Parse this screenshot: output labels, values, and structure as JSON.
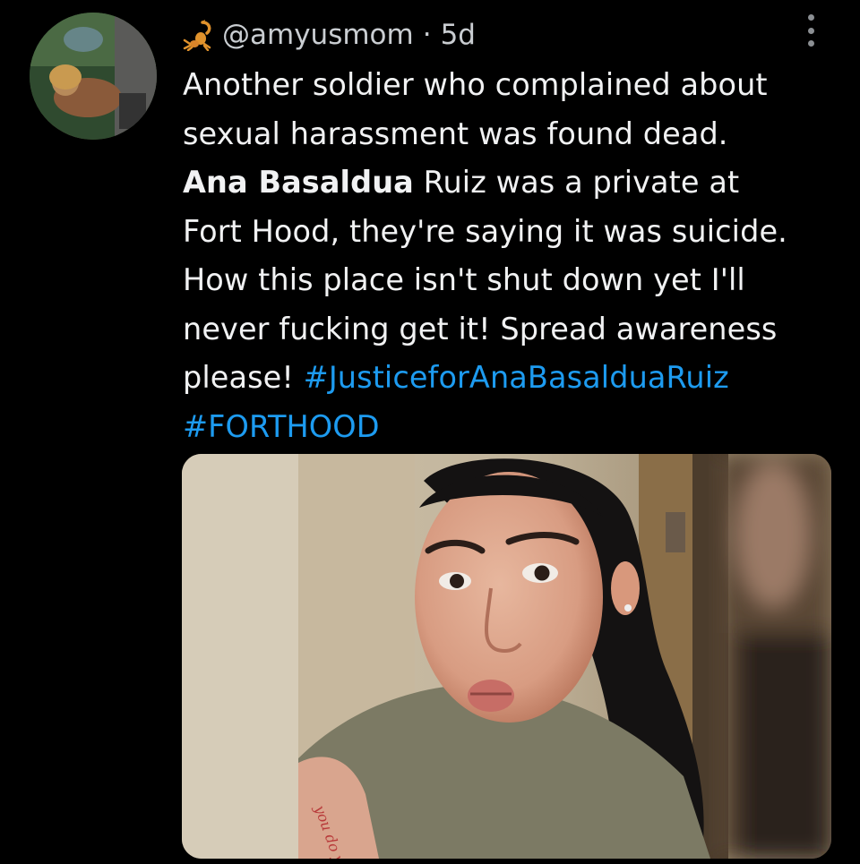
{
  "tweet": {
    "handle": "@amyusmom",
    "separator": "·",
    "time": "5d",
    "author_emoji_icon": "scorpion-icon",
    "text_lines": [
      [
        {
          "t": "Another soldier who complained about",
          "style": "normal"
        }
      ],
      [
        {
          "t": "sexual harassment was found dead.",
          "style": "normal"
        }
      ],
      [
        {
          "t": "Ana Basaldua",
          "style": "bold"
        },
        {
          "t": " Ruiz was a private at",
          "style": "normal"
        }
      ],
      [
        {
          "t": "Fort Hood, they're saying it was suicide.",
          "style": "normal"
        }
      ],
      [
        {
          "t": "How this place isn't shut down yet I'll",
          "style": "normal"
        }
      ],
      [
        {
          "t": "never fucking get it! Spread awareness",
          "style": "normal"
        }
      ],
      [
        {
          "t": "please! ",
          "style": "normal"
        },
        {
          "t": "#JusticeforAnaBasalduaRuiz",
          "style": "hashtag"
        }
      ],
      [
        {
          "t": "#FORTHOOD",
          "style": "hashtag"
        }
      ]
    ],
    "media_image": "selfie-photo",
    "tattoo_text": "you do you"
  },
  "colors": {
    "background": "#000000",
    "text": "#f1f2f3",
    "secondary_text": "#c9cdd1",
    "hashtag": "#1d9bf0"
  }
}
